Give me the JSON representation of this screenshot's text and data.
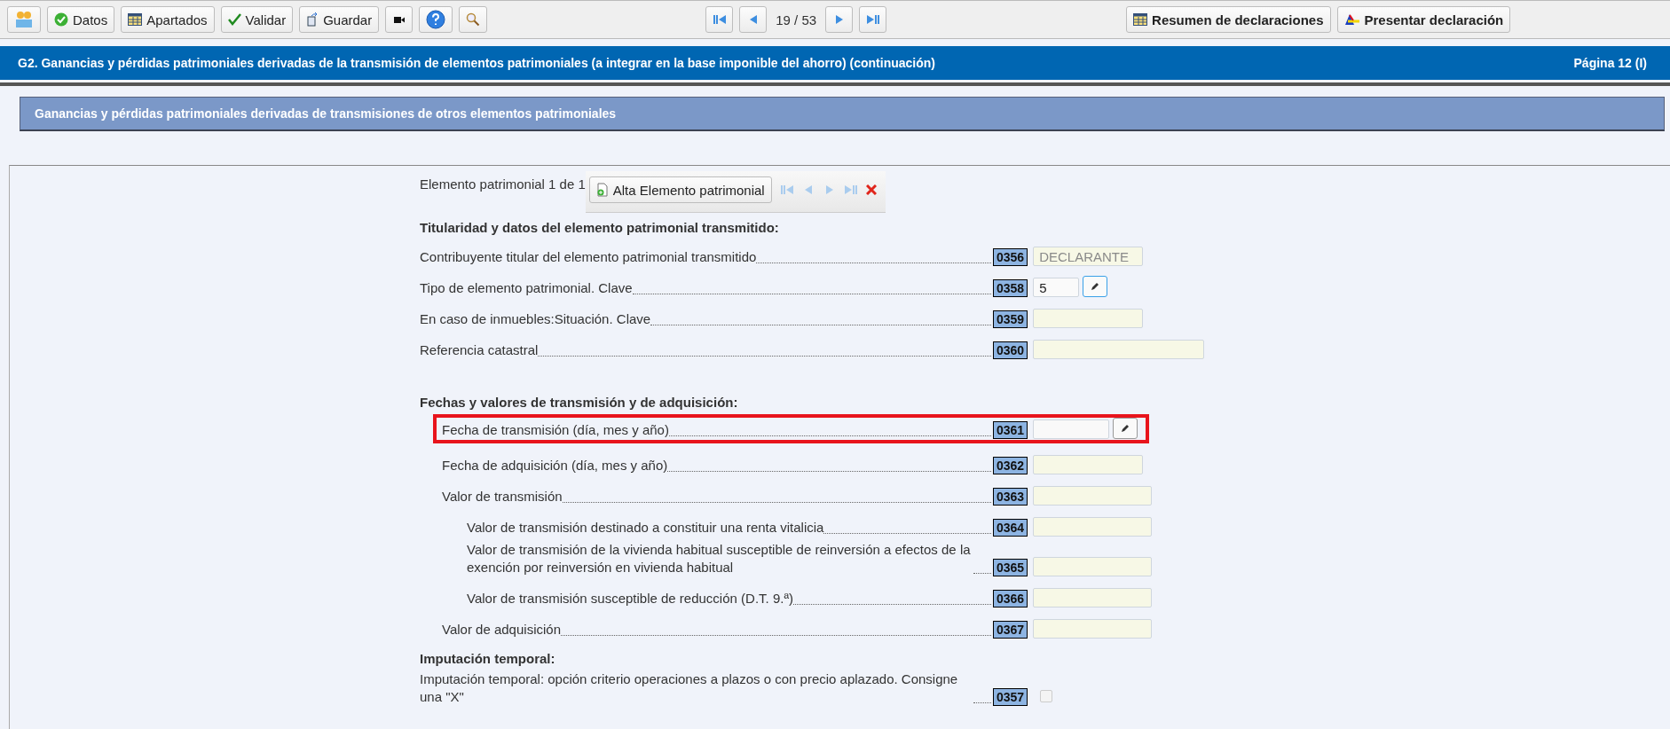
{
  "toolbar": {
    "buttons": [
      {
        "kind": "people"
      },
      {
        "kind": "check-circle",
        "label": "Datos"
      },
      {
        "kind": "table",
        "label": "Apartados"
      },
      {
        "kind": "check",
        "label": "Validar"
      },
      {
        "kind": "save",
        "label": "Guardar"
      },
      {
        "kind": "camera"
      },
      {
        "kind": "help"
      },
      {
        "kind": "search"
      }
    ],
    "pager": "19 / 53",
    "right_buttons": [
      {
        "kind": "table",
        "label": "Resumen de declaraciones"
      },
      {
        "kind": "logo",
        "label": "Presentar declaración"
      }
    ]
  },
  "header": {
    "title": "G2.  Ganancias y pérdidas patrimoniales derivadas de la transmisión de elementos patrimoniales (a integrar en la base imponible del ahorro) (continuación)",
    "page": "Página 12 (I)"
  },
  "subheader": "Ganancias y pérdidas patrimoniales derivadas de transmisiones de otros elementos patrimoniales",
  "element": {
    "counter": "Elemento patrimonial 1 de 1",
    "add_button": "Alta Elemento patrimonial"
  },
  "sections": [
    {
      "heading": "Titularidad y datos del elemento patrimonial transmitido:",
      "rows": [
        {
          "label": "Contribuyente titular del elemento patrimonial transmitido",
          "code": "0356",
          "kind": "list",
          "value": "DECLARANTE",
          "highlighted": false
        },
        {
          "label": "Tipo de elemento patrimonial. Clave",
          "code": "0358",
          "kind": "code",
          "value": "5",
          "highlighted": false
        },
        {
          "label": "En caso de inmuebles:Situación. Clave",
          "code": "0359",
          "kind": "short",
          "highlighted": false
        },
        {
          "label": "Referencia catastral",
          "code": "0360",
          "kind": "wide",
          "highlighted": false
        }
      ]
    },
    {
      "heading": "Fechas y valores de transmisión y de adquisición:",
      "rows": [
        {
          "label": "Fecha de transmisión (día, mes y año)",
          "code": "0361",
          "kind": "date",
          "highlighted": true
        },
        {
          "label": "Fecha de adquisición (día, mes y año)",
          "code": "0362",
          "kind": "short",
          "highlighted": false
        },
        {
          "label": "Valor de transmisión",
          "code": "0363",
          "kind": "amount",
          "highlighted": false,
          "children": [
            {
              "label": "Valor de transmisión destinado a constituir una renta vitalicia",
              "code": "0364",
              "kind": "amount",
              "highlighted": false
            },
            {
              "label": "Valor de transmisión de la vivienda habitual susceptible de reinversión a efectos de la exención por reinversión en vivienda habitual",
              "code": "0365",
              "kind": "amount",
              "highlighted": false
            },
            {
              "label": "Valor de transmisión susceptible de reducción (D.T. 9.ª)",
              "code": "0366",
              "kind": "amount",
              "highlighted": false
            }
          ]
        },
        {
          "label": "Valor de adquisición",
          "code": "0367",
          "kind": "amount",
          "highlighted": false
        }
      ]
    },
    {
      "heading": "Imputación temporal:",
      "rows": [
        {
          "label": "Imputación temporal: opción criterio operaciones a plazos o con precio aplazado. Consigne una \"X\"",
          "code": "0357",
          "kind": "checkbox",
          "checked": false,
          "highlighted": false
        }
      ]
    }
  ]
}
